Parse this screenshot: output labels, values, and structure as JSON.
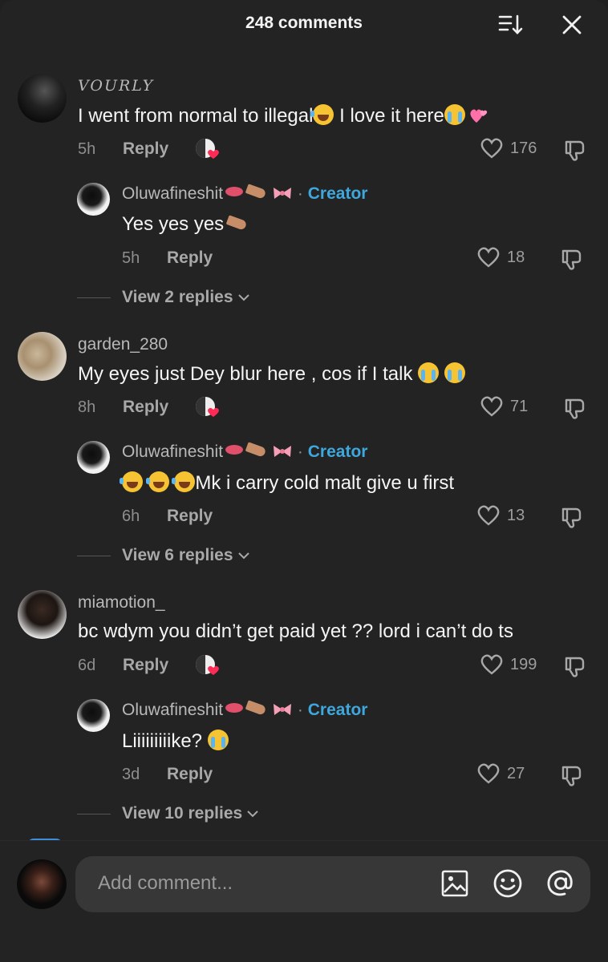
{
  "header": {
    "title": "248 comments"
  },
  "threads": [
    {
      "comment": {
        "username": "VOURLY",
        "text": "I went from normal to illegal",
        "text2": " I love it here",
        "time": "5h",
        "reply_label": "Reply",
        "likes": "176"
      },
      "reply": {
        "username": "Oluwafineshit",
        "badge": "Creator",
        "sep": "·",
        "text": "Yes yes yes",
        "time": "5h",
        "reply_label": "Reply",
        "likes": "18"
      },
      "view_replies": "View 2 replies"
    },
    {
      "comment": {
        "username": "garden_280",
        "text": "My eyes just Dey blur here , cos if I talk",
        "time": "8h",
        "reply_label": "Reply",
        "likes": "71"
      },
      "reply": {
        "username": "Oluwafineshit",
        "badge": "Creator",
        "sep": "·",
        "text": "Mk i carry cold malt give u first",
        "time": "6h",
        "reply_label": "Reply",
        "likes": "13"
      },
      "view_replies": "View 6 replies"
    },
    {
      "comment": {
        "username": "miamotion_",
        "text": "bc wdym you didn’t get paid yet ?? lord i can’t do ts",
        "time": "6d",
        "reply_label": "Reply",
        "likes": "199"
      },
      "reply": {
        "username": "Oluwafineshit",
        "badge": "Creator",
        "sep": "·",
        "text": "Liiiiiiiiike?",
        "time": "3d",
        "reply_label": "Reply",
        "likes": "27"
      },
      "view_replies": "View 10 replies"
    }
  ],
  "composer": {
    "placeholder": "Add comment..."
  },
  "icons": [
    "sort-icon",
    "close-icon",
    "creator-liked-icon",
    "heart-outline-icon",
    "dislike-icon",
    "chevron-down-icon",
    "image-icon",
    "emoji-icon",
    "mention-icon"
  ],
  "colors": {
    "background": "#232323",
    "creator": "#3ea8de",
    "input_bg": "#373737"
  }
}
